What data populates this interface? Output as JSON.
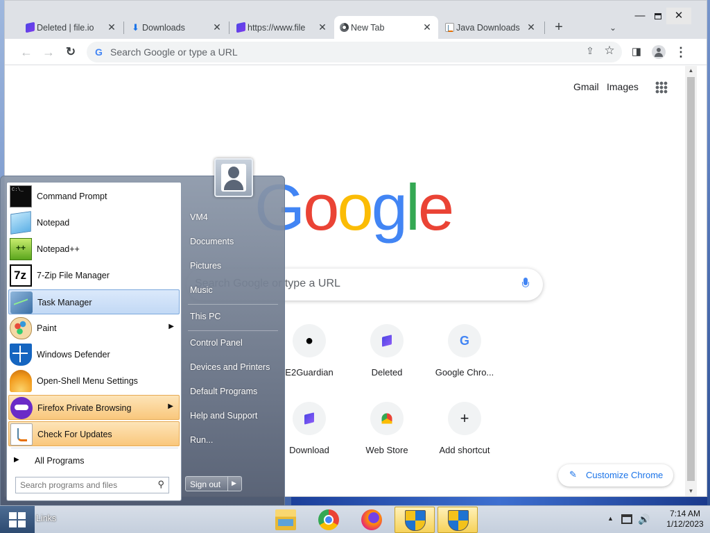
{
  "browser": {
    "tabs": [
      {
        "title": "Deleted | file.io",
        "icon": "file-io-icon",
        "active": false
      },
      {
        "title": "Downloads",
        "icon": "download-icon",
        "active": false
      },
      {
        "title": "https://www.file",
        "icon": "file-io-icon",
        "active": false
      },
      {
        "title": "New Tab",
        "icon": "chrome-icon",
        "active": true
      },
      {
        "title": "Java Downloads",
        "icon": "java-icon",
        "active": false
      }
    ],
    "new_tab_glyph": "+",
    "tab_search_glyph": "⌄",
    "window_controls": {
      "minimize": "—",
      "close": "✕"
    },
    "omnibox_placeholder": "Search Google or type a URL",
    "nav": {
      "back": "←",
      "forward": "→",
      "reload": "↻"
    }
  },
  "newtab": {
    "links": {
      "gmail": "Gmail",
      "images": "Images"
    },
    "logo_letters": [
      "G",
      "o",
      "o",
      "g",
      "l",
      "e"
    ],
    "search_placeholder": "Search Google or type a URL",
    "shortcuts": [
      {
        "label": "E2Guardian",
        "glyph": "github-icon",
        "char": ""
      },
      {
        "label": "Deleted",
        "glyph": "file-io-icon",
        "char": ""
      },
      {
        "label": "Google Chro...",
        "glyph": "google-g-icon",
        "char": "G"
      },
      {
        "label": "Download",
        "glyph": "file-io-icon",
        "char": ""
      },
      {
        "label": "Web Store",
        "glyph": "web-store-icon",
        "char": ""
      },
      {
        "label": "Add shortcut",
        "glyph": "plus-icon",
        "char": "+"
      }
    ],
    "customize_label": "Customize Chrome"
  },
  "start_menu": {
    "programs": [
      {
        "label": "Command Prompt",
        "icon": "command-prompt-icon",
        "submenu": false
      },
      {
        "label": "Notepad",
        "icon": "notepad-icon",
        "submenu": false
      },
      {
        "label": "Notepad++",
        "icon": "notepad-plus-plus-icon",
        "submenu": false
      },
      {
        "label": "7-Zip File Manager",
        "icon": "7zip-icon",
        "submenu": false
      },
      {
        "label": "Task Manager",
        "icon": "task-manager-icon",
        "submenu": false
      },
      {
        "label": "Paint",
        "icon": "paint-icon",
        "submenu": true
      },
      {
        "label": "Windows Defender",
        "icon": "defender-icon",
        "submenu": false
      },
      {
        "label": "Open-Shell Menu Settings",
        "icon": "open-shell-icon",
        "submenu": false
      },
      {
        "label": "Firefox Private Browsing",
        "icon": "firefox-private-icon",
        "submenu": true
      },
      {
        "label": "Check For Updates",
        "icon": "java-icon",
        "submenu": false
      }
    ],
    "all_programs": "All Programs",
    "search_placeholder": "Search programs and files",
    "right_items": [
      "VM4",
      "Documents",
      "Pictures",
      "Music",
      "This PC",
      "Control Panel",
      "Devices and Printers",
      "Default Programs",
      "Help and Support",
      "Run..."
    ],
    "sign_out": "Sign out",
    "arrow_right": "▶",
    "arrow_submenu": "▸"
  },
  "taskbar": {
    "links_label": "Links",
    "apps": [
      {
        "name": "file-explorer",
        "active": false
      },
      {
        "name": "chrome",
        "active": false
      },
      {
        "name": "firefox",
        "active": false
      },
      {
        "name": "uac-shield-1",
        "active": true
      },
      {
        "name": "uac-shield-2",
        "active": true
      }
    ],
    "clock": {
      "time": "7:14 AM",
      "date": "1/12/2023"
    }
  }
}
